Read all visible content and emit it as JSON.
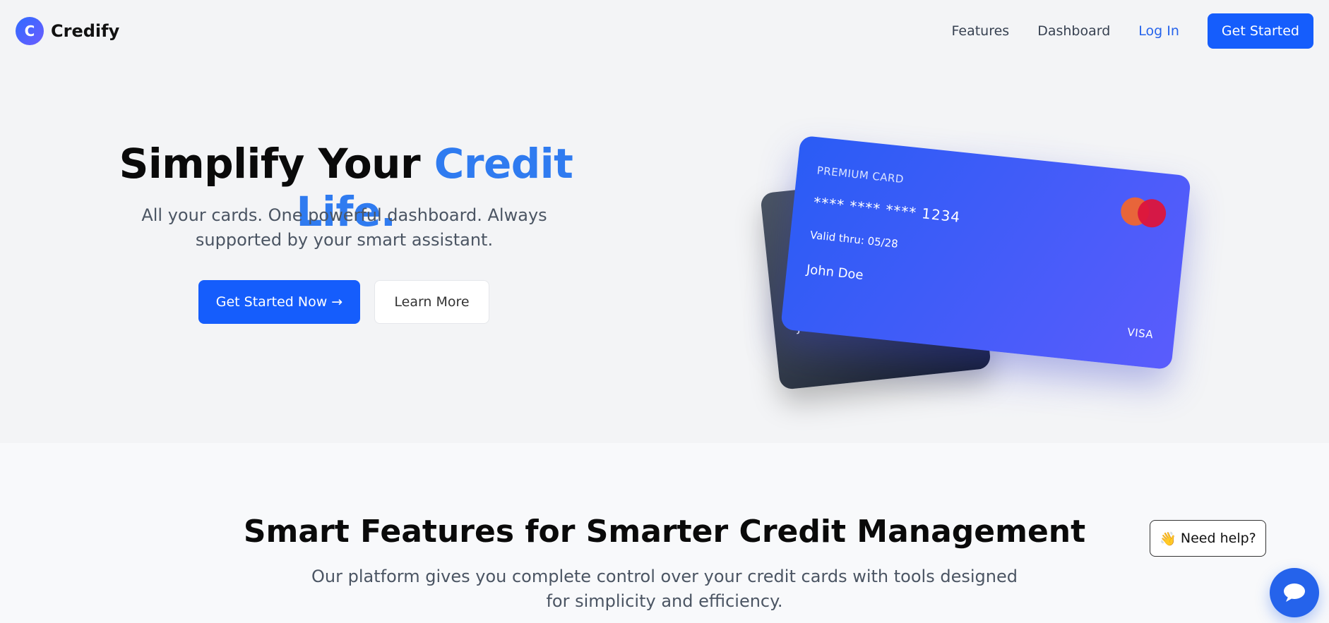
{
  "nav": {
    "brand_initial": "C",
    "brand_name": "Credify",
    "links": [
      "Features",
      "Dashboard",
      "Log In"
    ],
    "cta": "Get Started"
  },
  "hero": {
    "title_main": "Simplify Your ",
    "title_accent": "Credit Life.",
    "subtitle": "All your cards. One powerful dashboard. Always supported by your smart assistant.",
    "primary_button": "Get Started Now →",
    "secondary_button": "Learn More"
  },
  "cards": {
    "front": {
      "label": "PREMIUM CARD",
      "number": "**** **** **** 1234",
      "valid": "Valid thru: 05/28",
      "holder": "John Doe",
      "brand": "VISA"
    },
    "back": {
      "holder": "John Doe"
    }
  },
  "features": {
    "title": "Smart Features for Smarter Credit Management",
    "subtitle": "Our platform gives you complete control over your credit cards with tools designed for simplicity and efficiency."
  },
  "help": {
    "emoji": "👋",
    "label": "Need help?"
  },
  "colors": {
    "primary": "#155dfc",
    "accent_text": "#2f7bf0"
  }
}
